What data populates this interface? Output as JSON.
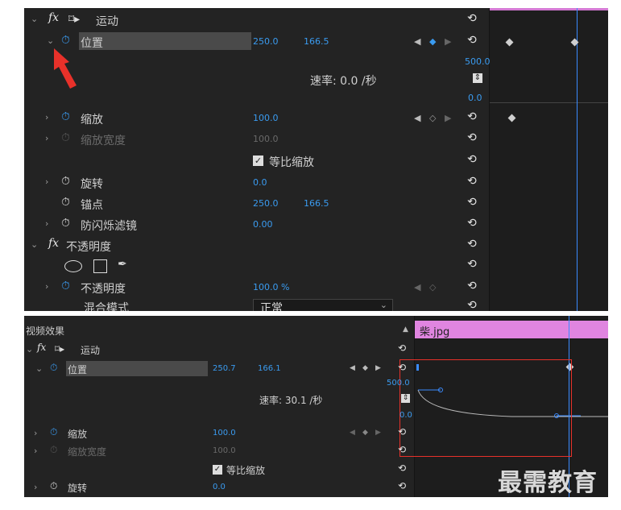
{
  "top": {
    "sections": {
      "motion": "运动",
      "opacity_section": "不透明度"
    },
    "position": {
      "label": "位置",
      "x": "250.0",
      "y": "166.5"
    },
    "speed": {
      "text": "速率: 0.0 /秒",
      "max": "500.0",
      "min": "0.0"
    },
    "scale": {
      "label": "缩放",
      "value": "100.0"
    },
    "scale_width": {
      "label": "缩放宽度",
      "value": "100.0"
    },
    "uniform": {
      "label": "等比缩放"
    },
    "rotation": {
      "label": "旋转",
      "value": "0.0"
    },
    "anchor": {
      "label": "锚点",
      "x": "250.0",
      "y": "166.5"
    },
    "anti_flicker": {
      "label": "防闪烁滤镜",
      "value": "0.00"
    },
    "opacity": {
      "label": "不透明度",
      "value": "100.0 %"
    },
    "blend": {
      "label": "混合模式",
      "value": "正常"
    }
  },
  "bottom": {
    "panel_title": "视频效果",
    "clip_name": "柴.jpg",
    "motion": "运动",
    "position": {
      "label": "位置",
      "x": "250.7",
      "y": "166.1"
    },
    "speed": {
      "text": "速率: 30.1 /秒",
      "max": "500.0",
      "min": "0.0"
    },
    "scale": {
      "label": "缩放",
      "value": "100.0"
    },
    "scale_width": {
      "label": "缩放宽度",
      "value": "100.0"
    },
    "uniform": {
      "label": "等比缩放"
    },
    "rotation": {
      "label": "旋转",
      "value": "0.0"
    }
  },
  "watermark": "最需教育",
  "icons": {
    "reset": "reset-icon",
    "stopwatch": "stopwatch-icon",
    "fx": "fx-icon",
    "arrow": "annotation-arrow"
  },
  "colors": {
    "panel_bg": "#232323",
    "timeline_bg": "#1d1d1d",
    "value_blue": "#3a9bf0",
    "playhead": "#3a8bff",
    "clip_pink": "#e085e0",
    "annotation_red": "#e8312a"
  }
}
